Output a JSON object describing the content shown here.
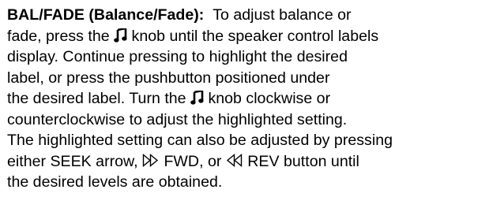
{
  "paragraph": {
    "heading": "BAL/FADE (Balance/Fade):",
    "line1_rest": "To adjust balance or",
    "line2_a": "fade, press the",
    "line2_b": "knob until the speaker control labels",
    "line3": "display. Continue pressing to highlight the desired",
    "line4": "label, or press the pushbutton positioned under",
    "line5_a": "the desired label. Turn the",
    "line5_b": "knob clockwise or",
    "line6": "counterclockwise to adjust the highlighted setting.",
    "line7": "The highlighted setting can also be adjusted by pressing",
    "line8_a": "either SEEK arrow,",
    "line8_b": "FWD, or",
    "line8_c": "REV button until",
    "line9": "the desired levels are obtained."
  },
  "icons": {
    "tone_knob": "music-note-icon",
    "forward": "fast-forward-icon",
    "reverse": "rewind-icon"
  }
}
